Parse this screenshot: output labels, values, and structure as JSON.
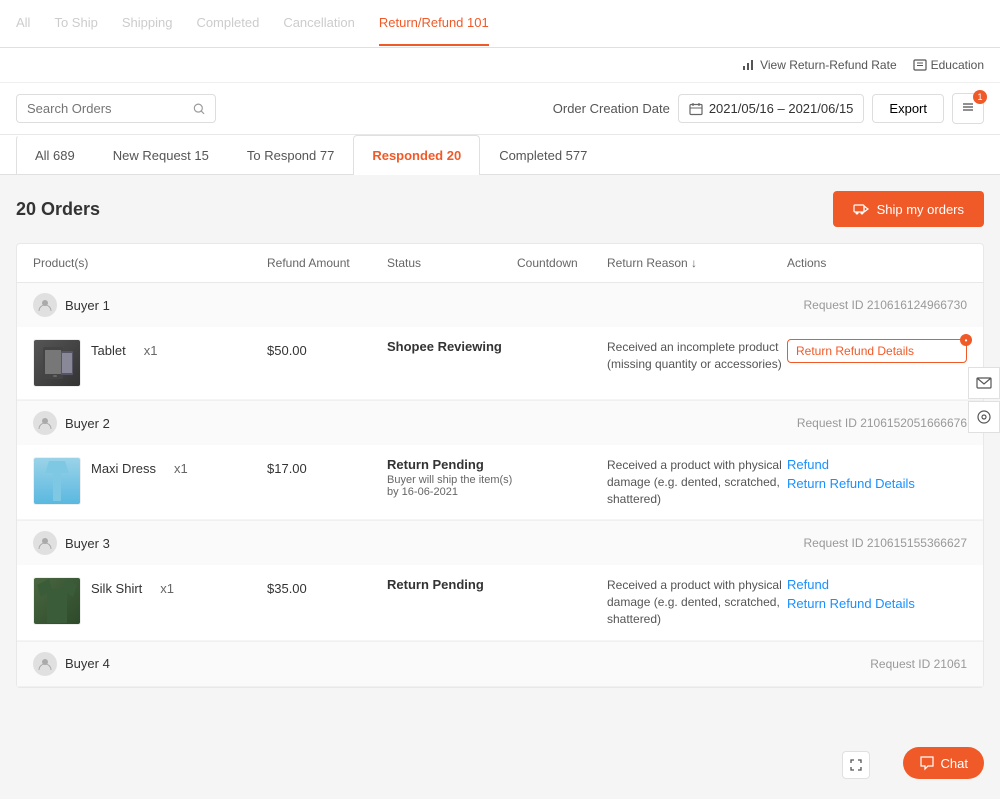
{
  "nav": {
    "items": [
      {
        "label": "All",
        "active": false,
        "blurred": true
      },
      {
        "label": "To Ship",
        "active": false,
        "blurred": true
      },
      {
        "label": "Shipping",
        "active": false,
        "blurred": true
      },
      {
        "label": "Completed",
        "active": false,
        "blurred": true
      },
      {
        "label": "Cancellation",
        "active": false,
        "blurred": true
      },
      {
        "label": "Return/Refund 101",
        "active": true,
        "blurred": false
      }
    ]
  },
  "toolbar": {
    "view_rate_label": "View Return-Refund Rate",
    "education_label": "Education"
  },
  "search": {
    "placeholder": "Search Orders"
  },
  "date_filter": {
    "label": "Order Creation Date",
    "value": "2021/05/16 – 2021/06/15"
  },
  "export_btn": "Export",
  "notification_count": "1",
  "tabs": [
    {
      "label": "All 689",
      "active": false
    },
    {
      "label": "New Request 15",
      "active": false
    },
    {
      "label": "To Respond 77",
      "active": false
    },
    {
      "label": "Responded 20",
      "active": true
    },
    {
      "label": "Completed 577",
      "active": false
    }
  ],
  "orders": {
    "title": "20 Orders",
    "ship_btn": "Ship my orders"
  },
  "table": {
    "headers": [
      "Product(s)",
      "Refund Amount",
      "Status",
      "Countdown",
      "Return Reason ↓",
      "Actions"
    ]
  },
  "rows": [
    {
      "buyer": "Buyer 1",
      "request_id": "Request ID 210616124966730",
      "product": "Tablet",
      "qty": "x1",
      "amount": "$50.00",
      "status": "Shopee Reviewing",
      "status_sub": "",
      "return_reason": "Received an incomplete product (missing quantity or accessories)",
      "actions": [
        "Return Refund Details"
      ],
      "action_style": "outline",
      "has_dot": true
    },
    {
      "buyer": "Buyer 2",
      "request_id": "Request ID 2106152051666676",
      "product": "Maxi Dress",
      "qty": "x1",
      "amount": "$17.00",
      "status": "Return Pending",
      "status_sub": "Buyer will ship the item(s) by 16-06-2021",
      "return_reason": "Received a product with physical damage (e.g. dented, scratched, shattered)",
      "actions": [
        "Refund",
        "Return Refund Details"
      ],
      "action_style": "link",
      "has_dot": false
    },
    {
      "buyer": "Buyer 3",
      "request_id": "Request ID 210615155366627",
      "product": "Silk Shirt",
      "qty": "x1",
      "amount": "$35.00",
      "status": "Return Pending",
      "status_sub": "",
      "return_reason": "Received a product with physical damage (e.g. dented, scratched, shattered)",
      "actions": [
        "Refund",
        "Return Refund Details"
      ],
      "action_style": "link",
      "has_dot": false
    },
    {
      "buyer": "Buyer 4",
      "request_id": "Request ID 21061",
      "product": "",
      "qty": "",
      "amount": "",
      "status": "",
      "status_sub": "",
      "return_reason": "",
      "actions": [],
      "action_style": "link",
      "has_dot": false
    }
  ],
  "chat_btn": "Chat"
}
